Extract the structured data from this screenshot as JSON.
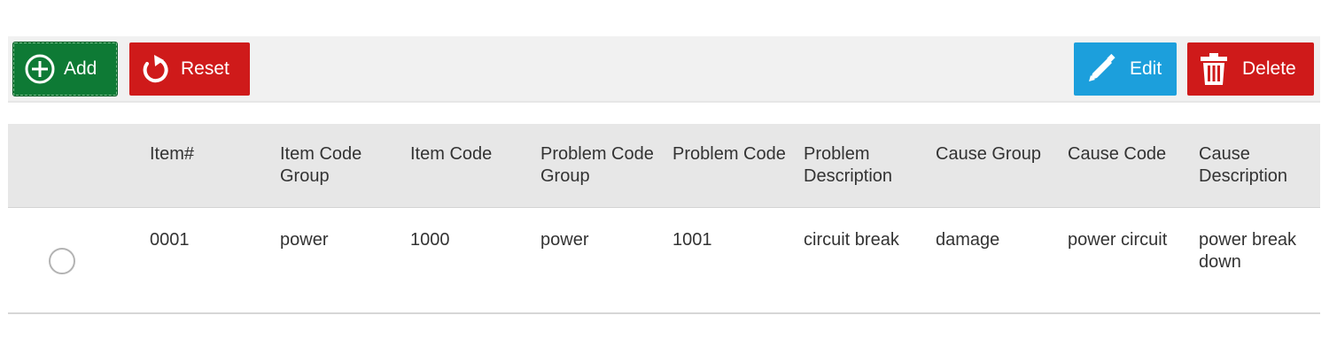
{
  "toolbar": {
    "add_label": "Add",
    "reset_label": "Reset",
    "edit_label": "Edit",
    "delete_label": "Delete",
    "add_icon": "plus-circle-icon",
    "reset_icon": "refresh-icon",
    "edit_icon": "pencil-icon",
    "delete_icon": "trash-icon",
    "colors": {
      "add": "#0e7a35",
      "reset": "#cf1a1a",
      "edit": "#1c9fdc",
      "delete": "#cf1a1a"
    }
  },
  "table": {
    "headers": [
      "Item#",
      "Item Code Group",
      "Item Code",
      "Problem Code Group",
      "Problem Code",
      "Problem Description",
      "Cause Group",
      "Cause Code",
      "Cause Description"
    ],
    "rows": [
      {
        "selected": false,
        "cells": [
          "0001",
          "power",
          "1000",
          "power",
          "1001",
          "circuit break",
          "damage",
          "power circuit",
          "power break down"
        ]
      }
    ]
  }
}
